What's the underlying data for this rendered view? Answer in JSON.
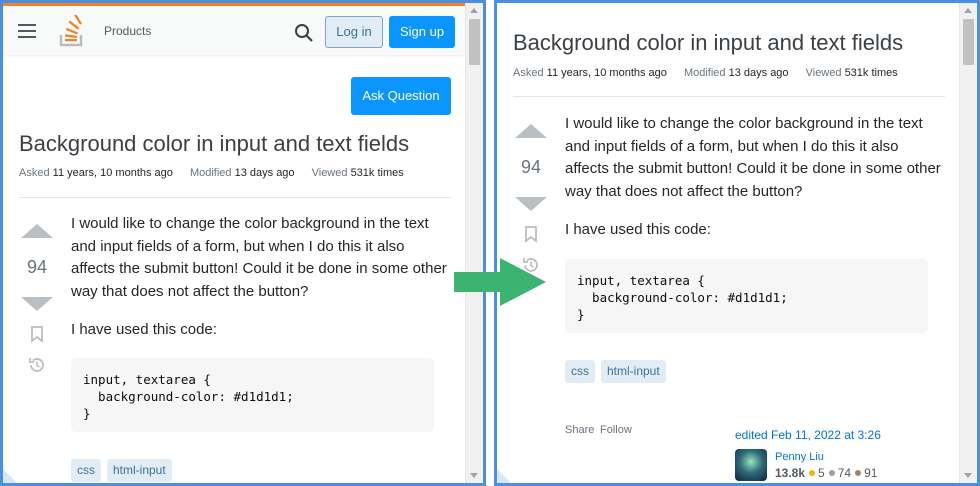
{
  "header": {
    "nav_products": "Products",
    "login_label": "Log in",
    "signup_label": "Sign up",
    "ask_label": "Ask Question"
  },
  "question": {
    "title": "Background color in input and text fields",
    "asked_label": "Asked",
    "asked_value": "11 years, 10 months ago",
    "modified_label": "Modified",
    "modified_value": "13 days ago",
    "viewed_label": "Viewed",
    "viewed_value": "531k times",
    "votes": "94",
    "paragraph1_left": "I would like to change the color background in the text and input fields of a form, but when I do this it also affects the submit button! Could it be done in some other way that does not affect the button?",
    "paragraph2": "I have used this code:",
    "code": "input, textarea {\n  background-color: #d1d1d1;\n}",
    "tags": [
      "css",
      "html-input"
    ]
  },
  "post_menu": {
    "share": "Share",
    "follow": "Follow"
  },
  "editor": {
    "edited": "edited Feb 11, 2022 at 3:26",
    "name": "Penny Liu",
    "reputation": "13.8k",
    "gold": "5",
    "silver": "74",
    "bronze": "91"
  },
  "colors": {
    "accent": "#0a95ff",
    "brand_orange": "#f48225",
    "frame": "#4a90e2",
    "arrow": "#3cb371"
  },
  "icons": [
    "hamburger-icon",
    "stackoverflow-logo-icon",
    "search-icon",
    "bookmark-icon",
    "history-icon",
    "vote-up-icon",
    "vote-down-icon",
    "right-arrow-icon"
  ]
}
